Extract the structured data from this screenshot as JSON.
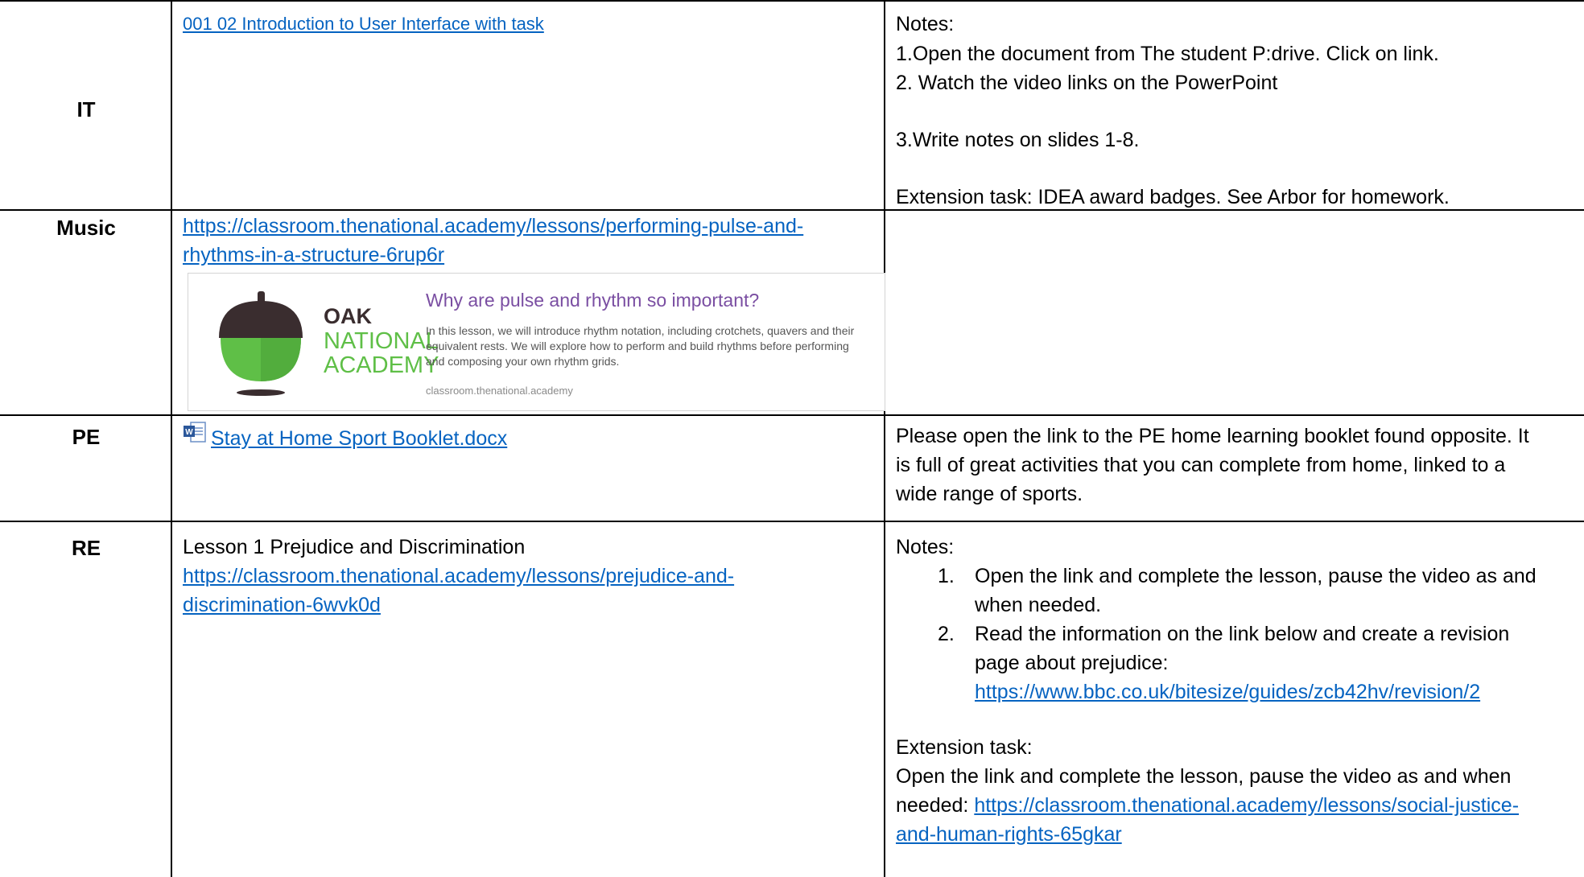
{
  "rows": {
    "it": {
      "subject": "IT",
      "link_text": "001 02 Introduction to User Interface with  task",
      "notes_label": "Notes:",
      "notes": [
        "1.Open the document from The student P:drive. Click on link.",
        "2. Watch the video links on the PowerPoint",
        "3.Write notes on slides 1-8.",
        "Extension task: IDEA award badges. See Arbor for homework."
      ]
    },
    "music": {
      "subject": "Music",
      "link_line1": "https://classroom.thenational.academy/lessons/performing-pulse-and-",
      "link_line2": "rhythms-in-a-structure-6rup6r",
      "preview": {
        "logo_line1": "OAK",
        "logo_line2": "NATIONAL",
        "logo_line3": "ACADEMY",
        "title": "Why are pulse and rhythm so important?",
        "description": "In this lesson, we will introduce rhythm notation, including crotchets, quavers and their equivalent rests. We will explore how to perform and build rhythms before performing and composing your own rhythm grids.",
        "domain": "classroom.thenational.academy"
      }
    },
    "pe": {
      "subject": "PE",
      "file_link": "Stay at Home Sport Booklet.docx",
      "file_icon": "word-document-icon",
      "notes": [
        "Please open the link to the PE home learning booklet found opposite. It",
        "is full of great activities that you can complete from home, linked to a",
        "wide range of sports."
      ]
    },
    "re": {
      "subject": "RE",
      "lesson_title": "Lesson 1 Prejudice and Discrimination",
      "link_line1": "https://classroom.thenational.academy/lessons/prejudice-and-",
      "link_line2": "discrimination-6wvk0d",
      "notes_label": "Notes:",
      "steps": [
        {
          "num": "1.",
          "line1": "Open the link and complete the lesson, pause the video as and",
          "line2": "when needed."
        },
        {
          "num": "2.",
          "line1": "Read the information on the link below and create a revision",
          "line2": "page about prejudice:",
          "link": "https://www.bbc.co.uk/bitesize/guides/zcb42hv/revision/2"
        }
      ],
      "extension_label": "Extension task:",
      "extension_line1": "Open the link and complete the lesson, pause the video as and when",
      "extension_line2_prefix": "needed: ",
      "extension_link_part1": "https://classroom.thenational.academy/lessons/social-justice-",
      "extension_link_part2": "and-human-rights-65gkar"
    }
  },
  "colors": {
    "link": "#0563c1",
    "border": "#000000",
    "oak_dark": "#3a2d2f",
    "oak_green": "#5fbf47",
    "oak_title": "#7a4ea2"
  }
}
